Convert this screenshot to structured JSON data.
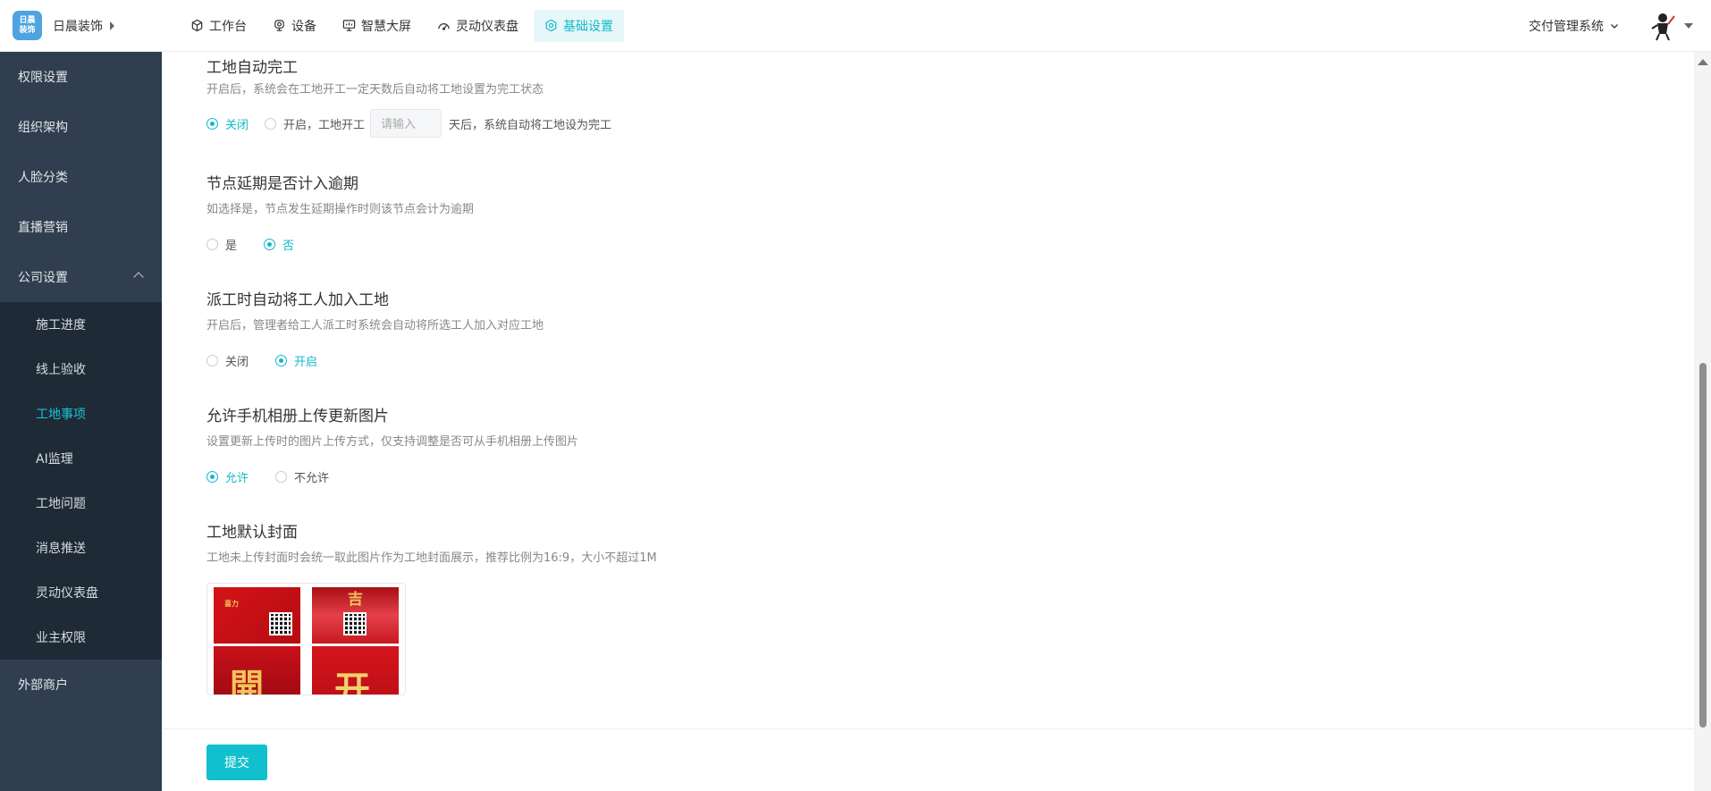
{
  "brand": {
    "name": "日晨装饰",
    "logo_text_top": "日晨",
    "logo_text_bottom": "装饰"
  },
  "nav": {
    "items": [
      {
        "label": "工作台",
        "icon": "cube-icon"
      },
      {
        "label": "设备",
        "icon": "camera-icon"
      },
      {
        "label": "智慧大屏",
        "icon": "monitor-icon"
      },
      {
        "label": "灵动仪表盘",
        "icon": "gauge-icon"
      },
      {
        "label": "基础设置",
        "icon": "settings-icon",
        "active": true
      }
    ]
  },
  "header_right": {
    "system_label": "交付管理系统"
  },
  "sidebar": {
    "items": [
      {
        "label": "权限设置"
      },
      {
        "label": "组织架构"
      },
      {
        "label": "人脸分类"
      },
      {
        "label": "直播营销"
      },
      {
        "label": "公司设置",
        "expanded": true
      }
    ],
    "submenu": [
      {
        "label": "施工进度"
      },
      {
        "label": "线上验收"
      },
      {
        "label": "工地事项",
        "active": true
      },
      {
        "label": "AI监理"
      },
      {
        "label": "工地问题"
      },
      {
        "label": "消息推送"
      },
      {
        "label": "灵动仪表盘"
      },
      {
        "label": "业主权限"
      }
    ],
    "bottom_item": {
      "label": "外部商户"
    }
  },
  "settings": {
    "auto_complete": {
      "title": "工地自动完工",
      "desc": "开启后，系统会在工地开工一定天数后自动将工地设置为完工状态",
      "option_off": "关闭",
      "option_on_prefix": "开启，工地开工",
      "input_placeholder": "请输入",
      "input_value": "",
      "option_on_suffix": "天后，系统自动将工地设为完工",
      "selected": "off"
    },
    "node_delay": {
      "title": "节点延期是否计入逾期",
      "desc": "如选择是，节点发生延期操作时则该节点会计为逾期",
      "option_yes": "是",
      "option_no": "否",
      "selected": "no"
    },
    "auto_add_worker": {
      "title": "派工时自动将工人加入工地",
      "desc": "开启后，管理者给工人派工时系统会自动将所选工人加入对应工地",
      "option_off": "关闭",
      "option_on": "开启",
      "selected": "on"
    },
    "album_upload": {
      "title": "允许手机相册上传更新图片",
      "desc": "设置更新上传时的图片上传方式，仅支持调整是否可从手机相册上传图片",
      "option_allow": "允许",
      "option_deny": "不允许",
      "selected": "allow"
    },
    "default_cover": {
      "title": "工地默认封面",
      "desc": "工地未上传封面时会统一取此图片作为工地封面展示，推荐比例为16:9，大小不超过1M",
      "thumb_texts": [
        "喜力",
        "吉",
        "開",
        "开"
      ]
    }
  },
  "footer": {
    "submit_label": "提交"
  },
  "colors": {
    "accent": "#0fbac9",
    "sidebar_bg": "#303e4f",
    "submenu_bg": "#1f2a37",
    "submit_bg": "#11c0cd"
  }
}
